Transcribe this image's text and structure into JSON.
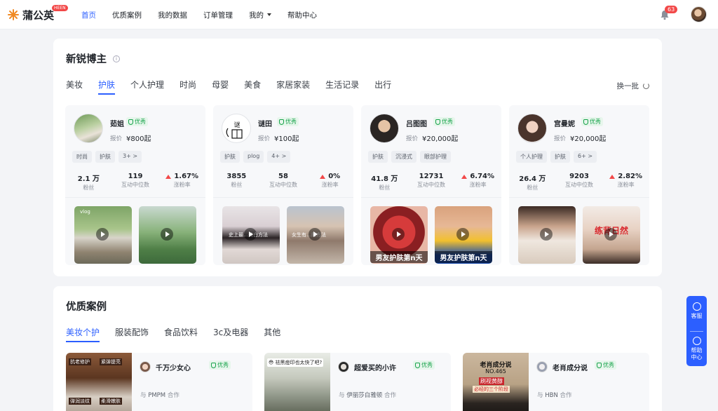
{
  "app": {
    "name": "蒲公英",
    "badge": "HEEN",
    "accent": "#2c5fff"
  },
  "nav": {
    "items": [
      {
        "label": "首页",
        "active": true
      },
      {
        "label": "优质案例"
      },
      {
        "label": "我的数据"
      },
      {
        "label": "订单管理"
      },
      {
        "label": "我的",
        "dropdown": true
      },
      {
        "label": "帮助中心"
      }
    ],
    "notification_count": "63"
  },
  "new_bloggers": {
    "title": "新锐博主",
    "tabs": [
      "美妆",
      "护肤",
      "个人护理",
      "时尚",
      "母婴",
      "美食",
      "家居家装",
      "生活记录",
      "出行"
    ],
    "active_tab": "护肤",
    "refresh_label": "换一批",
    "cards": [
      {
        "name": "茹姐",
        "badge": "优秀",
        "price_label": "报价",
        "price": "¥800起",
        "tags": [
          "时尚",
          "护肤",
          "3+ >"
        ],
        "stats": [
          {
            "value": "2.1 万",
            "label": "粉丝"
          },
          {
            "value": "119",
            "label": "互动中位数"
          },
          {
            "value": "1.67%",
            "label": "涨粉率"
          }
        ],
        "thumbs": [
          {
            "caption": "vlog"
          },
          {
            "caption": ""
          }
        ]
      },
      {
        "name": "谜田",
        "badge": "优秀",
        "price_label": "报价",
        "price": "¥100起",
        "tags": [
          "护肤",
          "plog",
          "4+ >"
        ],
        "stats": [
          {
            "value": "3855",
            "label": "粉丝"
          },
          {
            "value": "58",
            "label": "互动中位数"
          },
          {
            "value": "0%",
            "label": "涨粉率"
          }
        ],
        "thumbs": [
          {
            "caption": "史上最…美白方法"
          },
          {
            "caption": "女生有…的方法"
          }
        ]
      },
      {
        "name": "吕图图",
        "badge": "优秀",
        "price_label": "报价",
        "price": "¥20,000起",
        "tags": [
          "护肤",
          "沉浸式",
          "眼部护理"
        ],
        "stats": [
          {
            "value": "41.8 万",
            "label": "粉丝"
          },
          {
            "value": "12731",
            "label": "互动中位数"
          },
          {
            "value": "6.74%",
            "label": "涨粉率"
          }
        ],
        "thumbs": [
          {
            "caption": "男友护肤第n天"
          },
          {
            "caption": "男友护肤第n天"
          }
        ]
      },
      {
        "name": "宫曼妮",
        "badge": "优秀",
        "price_label": "报价",
        "price": "¥20,000起",
        "tags": [
          "个人护理",
          "护肤",
          "6+ >"
        ],
        "stats": [
          {
            "value": "26.4 万",
            "label": "粉丝"
          },
          {
            "value": "9203",
            "label": "互动中位数"
          },
          {
            "value": "2.82%",
            "label": "涨粉率"
          }
        ],
        "thumbs": [
          {
            "caption": ""
          },
          {
            "caption": "练背日然"
          }
        ]
      }
    ]
  },
  "cases": {
    "title": "优质案例",
    "tabs": [
      "美妆个护",
      "服装配饰",
      "食品饮料",
      "3c及电器",
      "其他"
    ],
    "active_tab": "美妆个护",
    "items": [
      {
        "name": "千万少女心",
        "badge": "优秀",
        "collab_pre": "与",
        "brand": "PMPM",
        "collab_post": "合作",
        "img_caption_top_left": "抗老修护",
        "img_caption_top_right": "紧弹提亮",
        "img_caption_bottom_left": "弹润淡纹",
        "img_caption_bottom_right": "柔滑嫩肤"
      },
      {
        "name": "超爱买的小许",
        "badge": "优秀",
        "collab_pre": "与",
        "brand": "伊丽莎白雅顿",
        "collab_post": "合作",
        "img_caption_top": "😳 祛黑痘印也太快了吧?"
      },
      {
        "name": "老肖成分说",
        "badge": "优秀",
        "collab_pre": "与",
        "brand": "HBN",
        "collab_post": "合作",
        "img_caption_top": "老肖成分说",
        "img_caption_mid": "NO.465",
        "img_caption_red": "刷视黄醇",
        "img_caption_sub": "必经的三个阶段"
      }
    ]
  },
  "float": {
    "service": "客服",
    "help": "帮助中心"
  }
}
